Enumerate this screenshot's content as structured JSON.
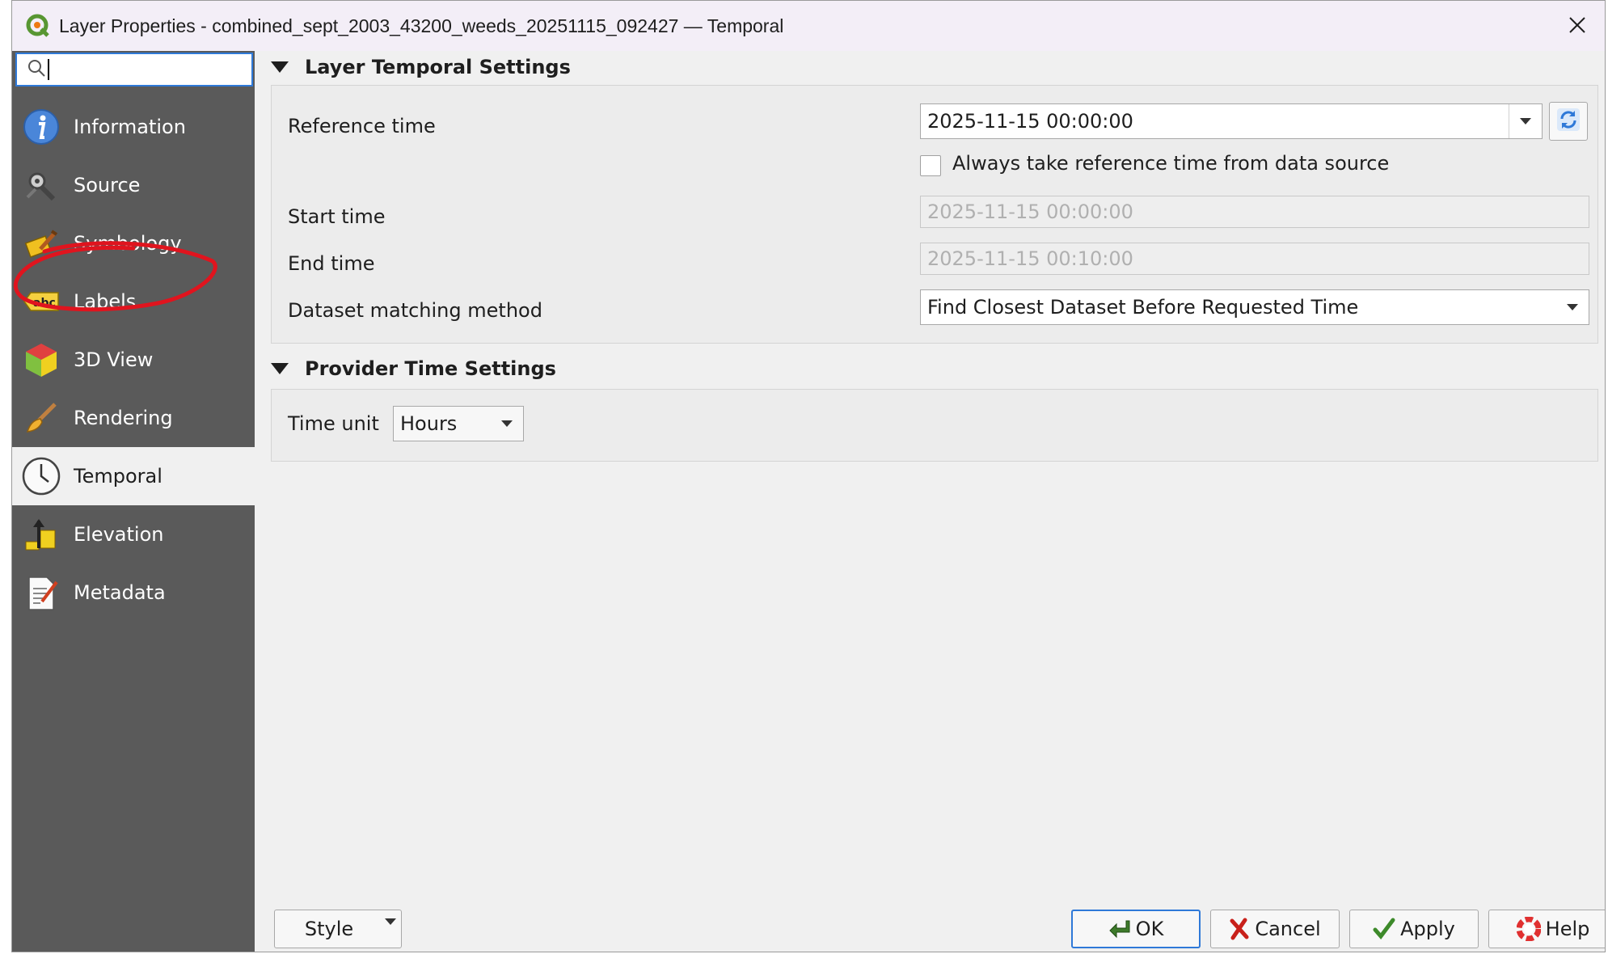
{
  "window": {
    "title": "Layer Properties - combined_sept_2003_43200_weeds_20251115_092427 — Temporal"
  },
  "search": {
    "placeholder": "",
    "value": ""
  },
  "sidebar": {
    "items": [
      {
        "label": "Information",
        "icon": "information-icon"
      },
      {
        "label": "Source",
        "icon": "source-icon"
      },
      {
        "label": "Symbology",
        "icon": "symbology-icon"
      },
      {
        "label": "Labels",
        "icon": "labels-icon"
      },
      {
        "label": "3D View",
        "icon": "3d-view-icon"
      },
      {
        "label": "Rendering",
        "icon": "rendering-icon"
      },
      {
        "label": "Temporal",
        "icon": "temporal-icon",
        "active": true
      },
      {
        "label": "Elevation",
        "icon": "elevation-icon"
      },
      {
        "label": "Metadata",
        "icon": "metadata-icon"
      }
    ]
  },
  "layer_temporal": {
    "header": "Layer Temporal Settings",
    "reference_time_label": "Reference time",
    "reference_time_value": "2025-11-15 00:00:00",
    "always_take_label": "Always take reference time from data source",
    "always_take_checked": false,
    "start_time_label": "Start time",
    "start_time_value": "2025-11-15 00:00:00",
    "end_time_label": "End time",
    "end_time_value": "2025-11-15 00:10:00",
    "dataset_matching_label": "Dataset matching method",
    "dataset_matching_value": "Find Closest Dataset Before Requested Time"
  },
  "provider_time": {
    "header": "Provider Time Settings",
    "time_unit_label": "Time unit",
    "time_unit_value": "Hours"
  },
  "buttons": {
    "style": "Style",
    "ok": "OK",
    "cancel": "Cancel",
    "apply": "Apply",
    "help": "Help"
  },
  "colors": {
    "sidebar_bg": "#5a5a5a",
    "accent": "#2f79d8",
    "annotation": "#e0141e"
  }
}
